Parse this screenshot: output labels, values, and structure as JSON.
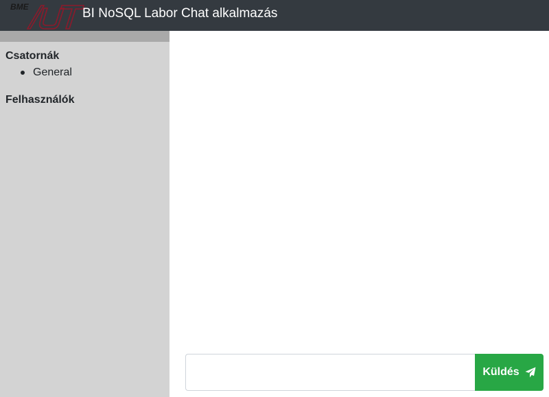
{
  "header": {
    "logo_small_text": "BME",
    "logo_icon": "aut-logo",
    "title": "BI NoSQL Labor Chat alkalmazás"
  },
  "sidebar": {
    "channels_title": "Csatornák",
    "channels": [
      {
        "label": "General"
      }
    ],
    "users_title": "Felhasználók",
    "users": []
  },
  "composer": {
    "input_value": "",
    "input_placeholder": "",
    "send_label": "Küldés",
    "send_icon": "paper-plane-icon"
  },
  "colors": {
    "navbar": "#343a40",
    "sidebar": "#d3d3d3",
    "send_button": "#28a745",
    "logo_red": "#8b1a2b"
  }
}
